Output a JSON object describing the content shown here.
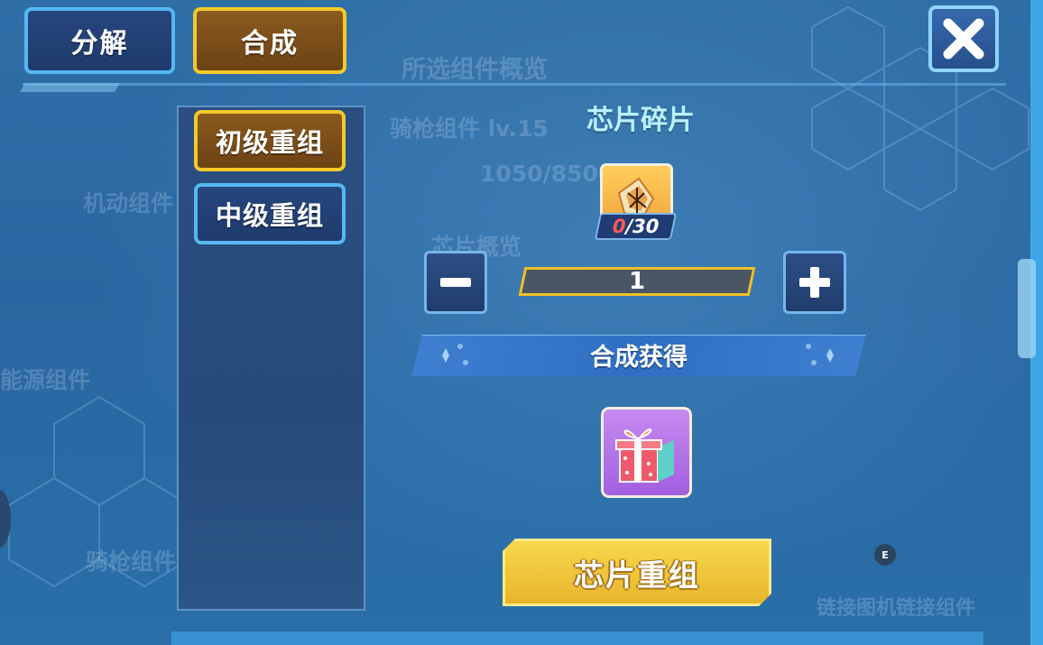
{
  "tabs": {
    "decompose": "分解",
    "compose": "合成"
  },
  "subtabs": {
    "basic": "初级重组",
    "intermediate": "中级重组"
  },
  "section": {
    "title": "芯片碎片"
  },
  "material": {
    "icon": "chip-fragment-icon",
    "owned": "0",
    "required": "/30"
  },
  "quantity": {
    "value": "1"
  },
  "reward": {
    "banner": "合成获得",
    "icon": "gift-box-icon"
  },
  "action": {
    "craft_label": "芯片重组"
  },
  "hint": {
    "key_badge": "E"
  },
  "background_faded": {
    "overview": "所选组件概览",
    "component": "骑枪组件 lv.15",
    "progress": "1050/8500",
    "chip_overview": "芯片概览",
    "mobile": "机动组件",
    "resource": "能源组件",
    "lance": "骑枪组件",
    "bottom_right": "链接图机链接组件"
  },
  "colors": {
    "accent_gold": "#f5c928",
    "accent_blue": "#56b8f2",
    "count_red": "#ff5a5a"
  }
}
